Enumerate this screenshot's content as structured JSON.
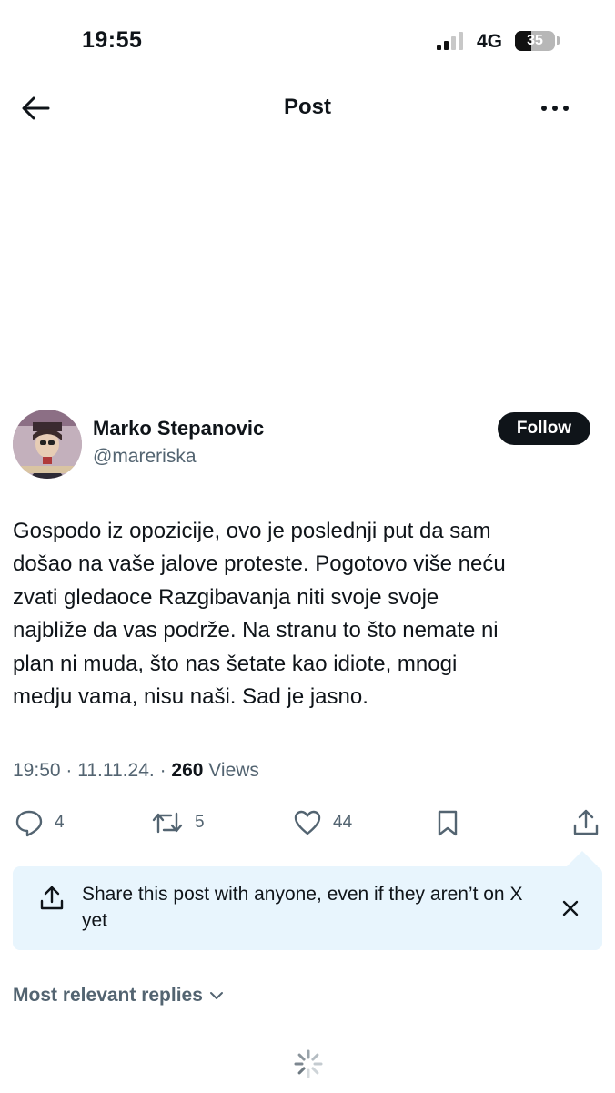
{
  "status_bar": {
    "time": "19:55",
    "network": "4G",
    "battery_level": "35"
  },
  "header": {
    "title": "Post",
    "back_icon": "arrow-left-icon",
    "more_icon": "more-horizontal-icon"
  },
  "post": {
    "author": {
      "name": "Marko Stepanovic",
      "handle": "@mareriska",
      "follow_label": "Follow"
    },
    "text": "Gospodo iz opozicije, ovo je poslednji put da sam\ndošao na vaše jalove proteste. Pogotovo više neću\nzvati gledaoce Razgibavanja niti svoje svoje\nnajbliže da vas podrže. Na stranu to što nemate ni\nplan ni muda, što nas šetate kao idiote, mnogi\nmedju vama, nisu naši. Sad je jasno.",
    "meta": {
      "time": "19:50",
      "date": "11.11.24.",
      "separator": "·",
      "views_count": "260",
      "views_label": "Views"
    },
    "actions": {
      "replies": "4",
      "reposts": "5",
      "likes": "44"
    }
  },
  "share_banner": {
    "text": "Share this post with anyone, even if they aren’t on X yet"
  },
  "replies_sort": {
    "label": "Most relevant replies"
  },
  "colors": {
    "primary_text": "#0f1419",
    "secondary_text": "#536471",
    "banner_bg": "#e8f5fd",
    "follow_bg": "#0f1419"
  }
}
